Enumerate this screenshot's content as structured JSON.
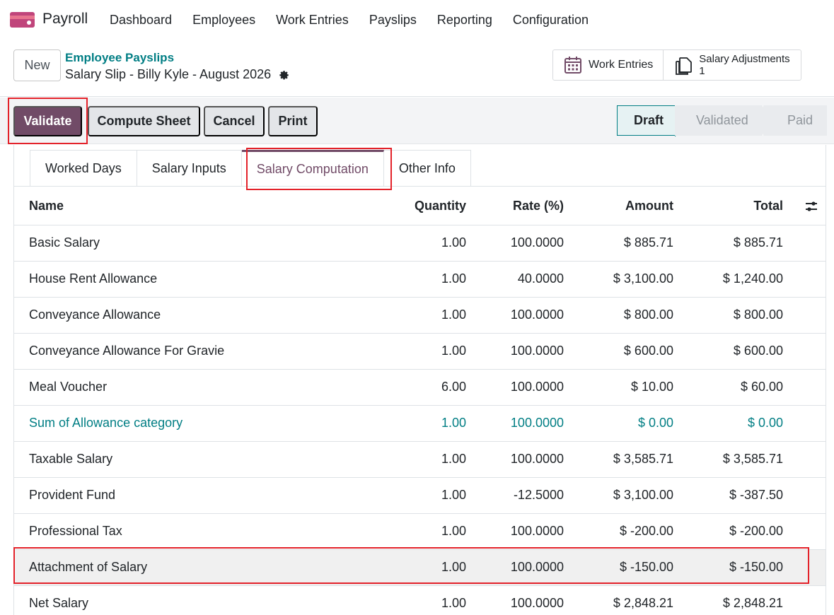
{
  "app": {
    "name": "Payroll"
  },
  "menu": [
    "Dashboard",
    "Employees",
    "Work Entries",
    "Payslips",
    "Reporting",
    "Configuration"
  ],
  "control": {
    "new_label": "New",
    "breadcrumb_parent": "Employee Payslips",
    "breadcrumb_current": "Salary Slip - Billy Kyle - August 2026"
  },
  "smart_buttons": {
    "work_entries": "Work Entries",
    "salary_adjustments": "Salary Adjustments",
    "salary_adjustments_count": "1"
  },
  "actions": {
    "validate": "Validate",
    "compute_sheet": "Compute Sheet",
    "cancel": "Cancel",
    "print": "Print"
  },
  "pipeline": {
    "draft": "Draft",
    "validated": "Validated",
    "paid": "Paid",
    "current": "Draft"
  },
  "tabs": [
    "Worked Days",
    "Salary Inputs",
    "Salary Computation",
    "Other Info"
  ],
  "active_tab": "Salary Computation",
  "table": {
    "headers": {
      "name": "Name",
      "quantity": "Quantity",
      "rate": "Rate (%)",
      "amount": "Amount",
      "total": "Total"
    },
    "rows": [
      {
        "name": "Basic Salary",
        "quantity": "1.00",
        "rate": "100.0000",
        "amount": "$ 885.71",
        "total": "$ 885.71"
      },
      {
        "name": "House Rent Allowance",
        "quantity": "1.00",
        "rate": "40.0000",
        "amount": "$ 3,100.00",
        "total": "$ 1,240.00"
      },
      {
        "name": "Conveyance Allowance",
        "quantity": "1.00",
        "rate": "100.0000",
        "amount": "$ 800.00",
        "total": "$ 800.00"
      },
      {
        "name": "Conveyance Allowance For Gravie",
        "quantity": "1.00",
        "rate": "100.0000",
        "amount": "$ 600.00",
        "total": "$ 600.00"
      },
      {
        "name": "Meal Voucher",
        "quantity": "6.00",
        "rate": "100.0000",
        "amount": "$ 10.00",
        "total": "$ 60.00"
      },
      {
        "name": "Sum of Allowance category",
        "quantity": "1.00",
        "rate": "100.0000",
        "amount": "$ 0.00",
        "total": "$ 0.00"
      },
      {
        "name": "Taxable Salary",
        "quantity": "1.00",
        "rate": "100.0000",
        "amount": "$ 3,585.71",
        "total": "$ 3,585.71"
      },
      {
        "name": "Provident Fund",
        "quantity": "1.00",
        "rate": "-12.5000",
        "amount": "$ 3,100.00",
        "total": "$ -387.50"
      },
      {
        "name": "Professional Tax",
        "quantity": "1.00",
        "rate": "100.0000",
        "amount": "$ -200.00",
        "total": "$ -200.00"
      },
      {
        "name": "Attachment of Salary",
        "quantity": "1.00",
        "rate": "100.0000",
        "amount": "$ -150.00",
        "total": "$ -150.00"
      },
      {
        "name": "Net Salary",
        "quantity": "1.00",
        "rate": "100.0000",
        "amount": "$ 2,848.21",
        "total": "$ 2,848.21"
      }
    ]
  },
  "colors": {
    "primary": "#714b67",
    "link": "#017e84",
    "highlight": "#e3222a"
  }
}
